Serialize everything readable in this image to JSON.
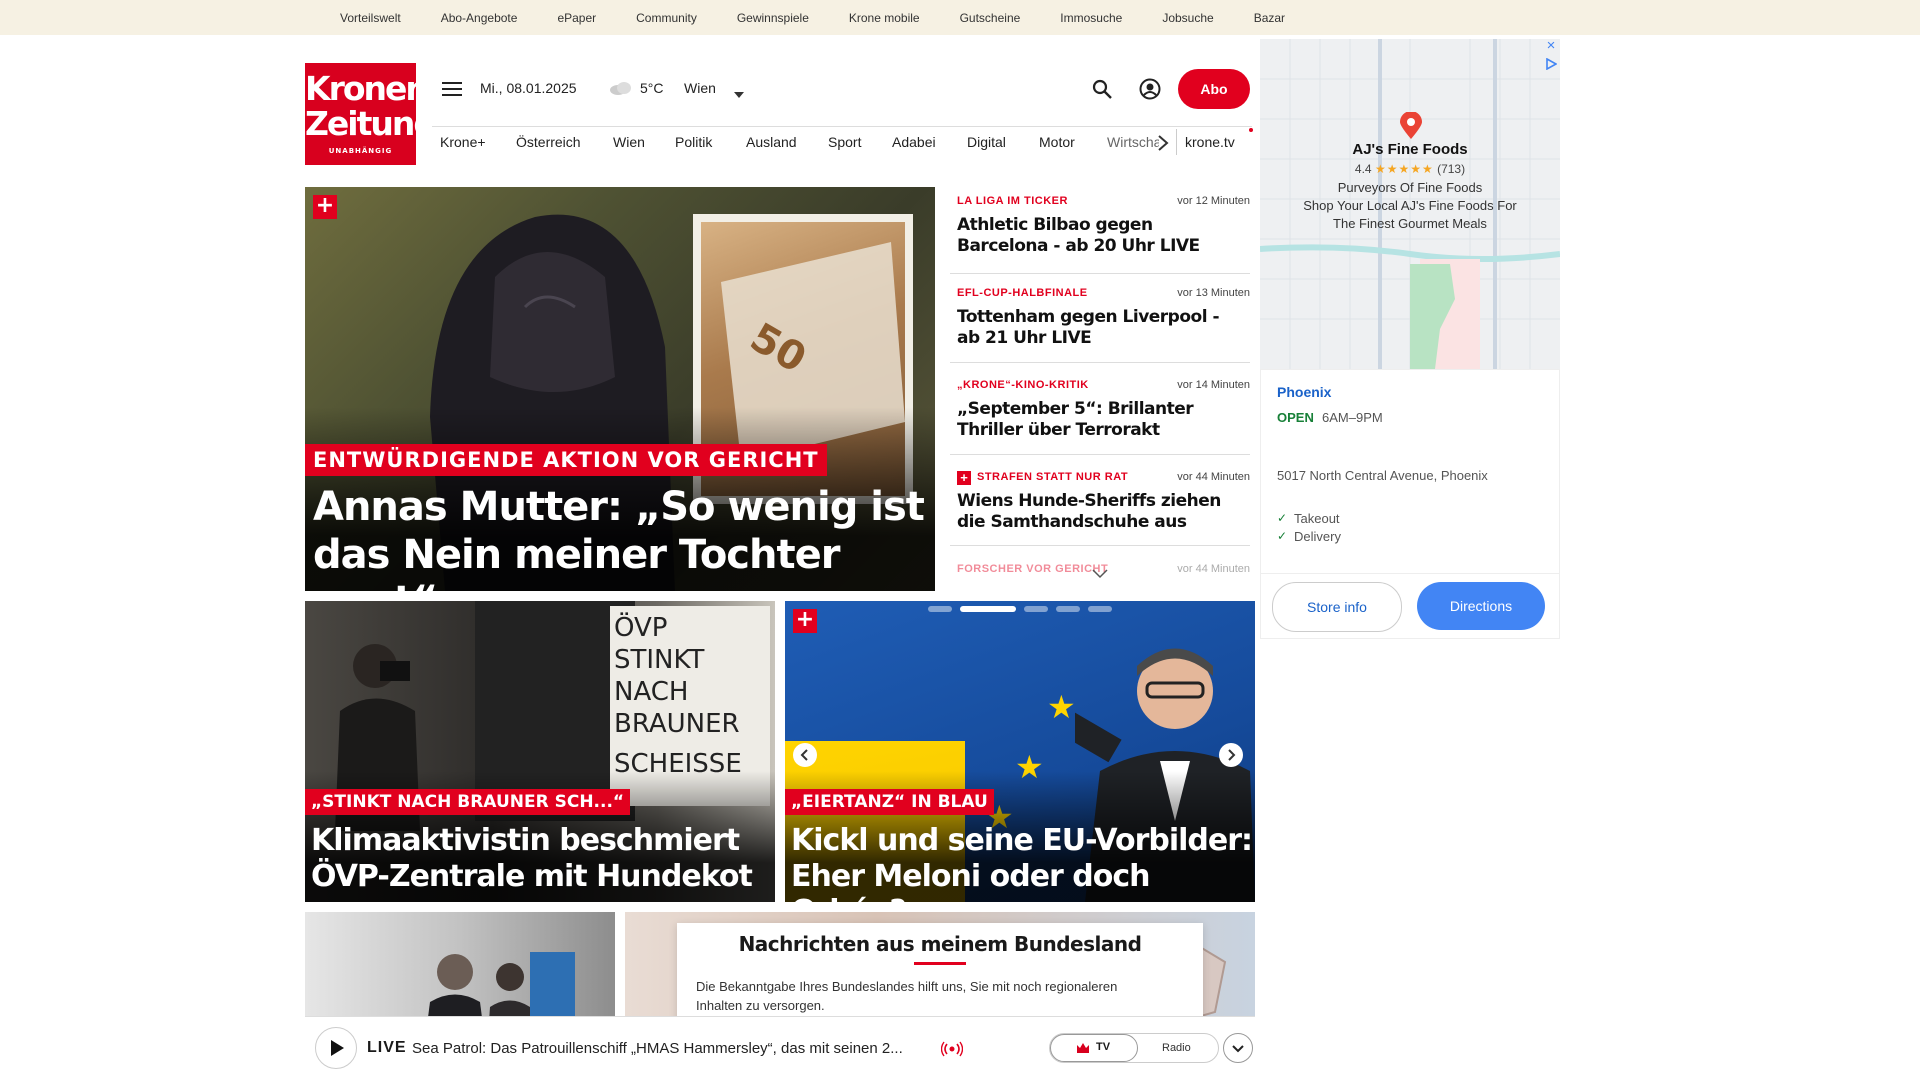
{
  "utility_nav": [
    "Vorteilswelt",
    "Abo-Angebote",
    "ePaper",
    "Community",
    "Gewinnspiele",
    "Krone mobile",
    "Gutscheine",
    "Immosuche",
    "Jobsuche",
    "Bazar"
  ],
  "logo": {
    "line1": "Kronen",
    "line2": "Zeitung",
    "line3": "UNABHÄNGIG"
  },
  "header": {
    "date": "Mi., 08.01.2025",
    "temperature": "5°C",
    "city": "Wien",
    "subscribe_label": "Abo"
  },
  "nav": {
    "items": [
      "Krone+",
      "Österreich",
      "Wien",
      "Politik",
      "Ausland",
      "Sport",
      "Adabei",
      "Digital",
      "Motor",
      "Wirtschaft"
    ],
    "tv_label": "krone.tv"
  },
  "hero": {
    "kicker": "ENTWÜRDIGENDE AKTION VOR GERICHT",
    "headline_l1": "Annas Mutter: „So wenig ist",
    "headline_l2": "das Nein meiner Tochter wert“",
    "plus": "+"
  },
  "side_list": [
    {
      "category": "LA LIGA IM TICKER",
      "time": "vor 12 Minuten",
      "title": "Athletic Bilbao gegen Barcelona - ab 20 Uhr LIVE"
    },
    {
      "category": "EFL-CUP-HALBFINALE",
      "time": "vor 13 Minuten",
      "title": "Tottenham gegen Liverpool - ab 21 Uhr LIVE"
    },
    {
      "category": "„KRONE“-KINO-KRITIK",
      "time": "vor 14 Minuten",
      "title": "„September 5“: Brillanter Thriller über Terrorakt"
    },
    {
      "category": "STRAFEN STATT NUR RAT",
      "time": "vor 44 Minuten",
      "title": "Wiens Hunde-Sheriffs ziehen die Samthandschuhe aus"
    },
    {
      "category": "FORSCHER VOR GERICHT",
      "time": "vor 44 Minuten",
      "title": ""
    }
  ],
  "card_left": {
    "kicker": "„STINKT NACH BRAUNER SCH...“",
    "headline_l1": "Klimaaktivistin beschmiert",
    "headline_l2": "ÖVP-Zentrale mit Hundekot",
    "graffiti": [
      "ÖVP",
      "STINKT",
      "NACH",
      "BRAUNER",
      "SCHEISSE"
    ]
  },
  "card_right": {
    "kicker": "„EIERTANZ“ IN BLAU",
    "headline_l1": "Kickl und seine EU-Vorbilder:",
    "headline_l2": "Eher Meloni oder doch Orbán?",
    "plus": "+",
    "slides": 5,
    "active_slide": 2
  },
  "popup": {
    "title": "Nachrichten aus meinem Bundesland",
    "text_l1": "Die Bekanntgabe Ihres Bundeslandes hilft uns, Sie mit noch regionaleren",
    "text_l2": "Inhalten zu versorgen."
  },
  "player": {
    "live_label": "LIVE",
    "title": "Sea Patrol: Das Patrouillenschiff „HMAS Hammersley“, das mit seinen 2...",
    "tv_label": "TV",
    "radio_label": "Radio"
  },
  "ad": {
    "business": "AJ's Fine Foods",
    "rating": "4.4",
    "stars": 4.5,
    "reviews": "(713)",
    "desc_l1": "Purveyors Of Fine Foods",
    "desc_l2": "Shop Your Local AJ's Fine Foods For",
    "desc_l3": "The Finest Gourmet Meals",
    "city": "Phoenix",
    "status": "OPEN",
    "hours": "6AM–9PM",
    "address": "5017 North Central Avenue, Phoenix",
    "features": [
      "Takeout",
      "Delivery"
    ],
    "store_info_label": "Store info",
    "directions_label": "Directions",
    "close": "×"
  },
  "colors": {
    "brand_red": "#e1001e",
    "utility_bg": "#f6f1e3",
    "ad_blue": "#4285f4",
    "open_green": "#188038"
  }
}
